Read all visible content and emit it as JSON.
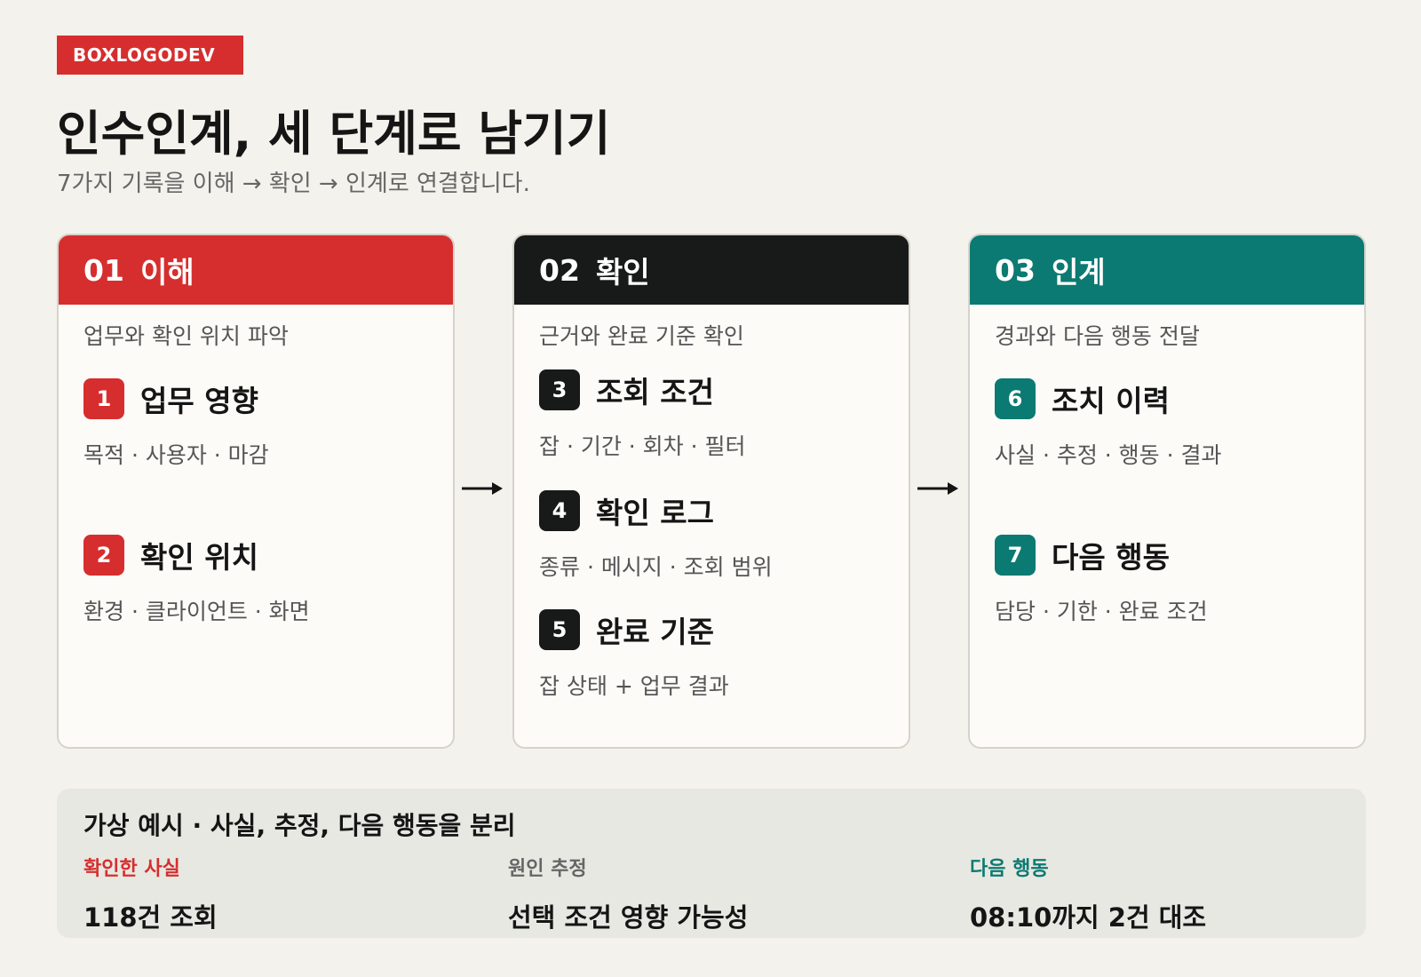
{
  "brand": "BOXLOGODEV",
  "title": "인수인계, 세 단계로 남기기",
  "subtitle": "7가지 기록을 이해 → 확인 → 인계로 연결합니다.",
  "colors": {
    "red": "#d62e2e",
    "black": "#171a18",
    "teal": "#0b7a72",
    "background": "#f4f2ec"
  },
  "stages": [
    {
      "num": "01",
      "label": "이해",
      "desc": "업무와 확인 위치 파악",
      "steps": [
        {
          "n": "1",
          "title": "업무 영향",
          "detail": "목적 · 사용자 · 마감"
        },
        {
          "n": "2",
          "title": "확인 위치",
          "detail": "환경 · 클라이언트 · 화면"
        }
      ]
    },
    {
      "num": "02",
      "label": "확인",
      "desc": "근거와 완료 기준 확인",
      "steps": [
        {
          "n": "3",
          "title": "조회 조건",
          "detail": "잡 · 기간 · 회차 · 필터"
        },
        {
          "n": "4",
          "title": "확인 로그",
          "detail": "종류 · 메시지 · 조회 범위"
        },
        {
          "n": "5",
          "title": "완료 기준",
          "detail": "잡 상태 + 업무 결과"
        }
      ]
    },
    {
      "num": "03",
      "label": "인계",
      "desc": "경과와 다음 행동 전달",
      "steps": [
        {
          "n": "6",
          "title": "조치 이력",
          "detail": "사실 · 추정 · 행동 · 결과"
        },
        {
          "n": "7",
          "title": "다음 행동",
          "detail": "담당 · 기한 · 완료 조건"
        }
      ]
    }
  ],
  "summary": {
    "title": "가상 예시 · 사실, 추정, 다음 행동을 분리",
    "columns": [
      {
        "label": "확인한 사실",
        "value": "118건 조회"
      },
      {
        "label": "원인 추정",
        "value": "선택 조건 영향 가능성"
      },
      {
        "label": "다음 행동",
        "value": "08:10까지 2건 대조"
      }
    ]
  }
}
